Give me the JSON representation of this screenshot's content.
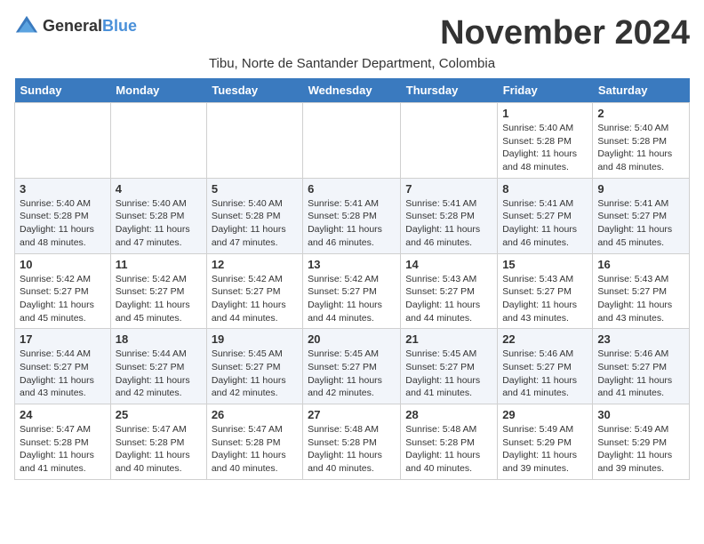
{
  "header": {
    "logo_general": "General",
    "logo_blue": "Blue",
    "month_title": "November 2024",
    "subtitle": "Tibu, Norte de Santander Department, Colombia"
  },
  "weekdays": [
    "Sunday",
    "Monday",
    "Tuesday",
    "Wednesday",
    "Thursday",
    "Friday",
    "Saturday"
  ],
  "weeks": [
    [
      {
        "day": "",
        "sunrise": "",
        "sunset": "",
        "daylight": ""
      },
      {
        "day": "",
        "sunrise": "",
        "sunset": "",
        "daylight": ""
      },
      {
        "day": "",
        "sunrise": "",
        "sunset": "",
        "daylight": ""
      },
      {
        "day": "",
        "sunrise": "",
        "sunset": "",
        "daylight": ""
      },
      {
        "day": "",
        "sunrise": "",
        "sunset": "",
        "daylight": ""
      },
      {
        "day": "1",
        "sunrise": "Sunrise: 5:40 AM",
        "sunset": "Sunset: 5:28 PM",
        "daylight": "Daylight: 11 hours and 48 minutes."
      },
      {
        "day": "2",
        "sunrise": "Sunrise: 5:40 AM",
        "sunset": "Sunset: 5:28 PM",
        "daylight": "Daylight: 11 hours and 48 minutes."
      }
    ],
    [
      {
        "day": "3",
        "sunrise": "Sunrise: 5:40 AM",
        "sunset": "Sunset: 5:28 PM",
        "daylight": "Daylight: 11 hours and 48 minutes."
      },
      {
        "day": "4",
        "sunrise": "Sunrise: 5:40 AM",
        "sunset": "Sunset: 5:28 PM",
        "daylight": "Daylight: 11 hours and 47 minutes."
      },
      {
        "day": "5",
        "sunrise": "Sunrise: 5:40 AM",
        "sunset": "Sunset: 5:28 PM",
        "daylight": "Daylight: 11 hours and 47 minutes."
      },
      {
        "day": "6",
        "sunrise": "Sunrise: 5:41 AM",
        "sunset": "Sunset: 5:28 PM",
        "daylight": "Daylight: 11 hours and 46 minutes."
      },
      {
        "day": "7",
        "sunrise": "Sunrise: 5:41 AM",
        "sunset": "Sunset: 5:28 PM",
        "daylight": "Daylight: 11 hours and 46 minutes."
      },
      {
        "day": "8",
        "sunrise": "Sunrise: 5:41 AM",
        "sunset": "Sunset: 5:27 PM",
        "daylight": "Daylight: 11 hours and 46 minutes."
      },
      {
        "day": "9",
        "sunrise": "Sunrise: 5:41 AM",
        "sunset": "Sunset: 5:27 PM",
        "daylight": "Daylight: 11 hours and 45 minutes."
      }
    ],
    [
      {
        "day": "10",
        "sunrise": "Sunrise: 5:42 AM",
        "sunset": "Sunset: 5:27 PM",
        "daylight": "Daylight: 11 hours and 45 minutes."
      },
      {
        "day": "11",
        "sunrise": "Sunrise: 5:42 AM",
        "sunset": "Sunset: 5:27 PM",
        "daylight": "Daylight: 11 hours and 45 minutes."
      },
      {
        "day": "12",
        "sunrise": "Sunrise: 5:42 AM",
        "sunset": "Sunset: 5:27 PM",
        "daylight": "Daylight: 11 hours and 44 minutes."
      },
      {
        "day": "13",
        "sunrise": "Sunrise: 5:42 AM",
        "sunset": "Sunset: 5:27 PM",
        "daylight": "Daylight: 11 hours and 44 minutes."
      },
      {
        "day": "14",
        "sunrise": "Sunrise: 5:43 AM",
        "sunset": "Sunset: 5:27 PM",
        "daylight": "Daylight: 11 hours and 44 minutes."
      },
      {
        "day": "15",
        "sunrise": "Sunrise: 5:43 AM",
        "sunset": "Sunset: 5:27 PM",
        "daylight": "Daylight: 11 hours and 43 minutes."
      },
      {
        "day": "16",
        "sunrise": "Sunrise: 5:43 AM",
        "sunset": "Sunset: 5:27 PM",
        "daylight": "Daylight: 11 hours and 43 minutes."
      }
    ],
    [
      {
        "day": "17",
        "sunrise": "Sunrise: 5:44 AM",
        "sunset": "Sunset: 5:27 PM",
        "daylight": "Daylight: 11 hours and 43 minutes."
      },
      {
        "day": "18",
        "sunrise": "Sunrise: 5:44 AM",
        "sunset": "Sunset: 5:27 PM",
        "daylight": "Daylight: 11 hours and 42 minutes."
      },
      {
        "day": "19",
        "sunrise": "Sunrise: 5:45 AM",
        "sunset": "Sunset: 5:27 PM",
        "daylight": "Daylight: 11 hours and 42 minutes."
      },
      {
        "day": "20",
        "sunrise": "Sunrise: 5:45 AM",
        "sunset": "Sunset: 5:27 PM",
        "daylight": "Daylight: 11 hours and 42 minutes."
      },
      {
        "day": "21",
        "sunrise": "Sunrise: 5:45 AM",
        "sunset": "Sunset: 5:27 PM",
        "daylight": "Daylight: 11 hours and 41 minutes."
      },
      {
        "day": "22",
        "sunrise": "Sunrise: 5:46 AM",
        "sunset": "Sunset: 5:27 PM",
        "daylight": "Daylight: 11 hours and 41 minutes."
      },
      {
        "day": "23",
        "sunrise": "Sunrise: 5:46 AM",
        "sunset": "Sunset: 5:27 PM",
        "daylight": "Daylight: 11 hours and 41 minutes."
      }
    ],
    [
      {
        "day": "24",
        "sunrise": "Sunrise: 5:47 AM",
        "sunset": "Sunset: 5:28 PM",
        "daylight": "Daylight: 11 hours and 41 minutes."
      },
      {
        "day": "25",
        "sunrise": "Sunrise: 5:47 AM",
        "sunset": "Sunset: 5:28 PM",
        "daylight": "Daylight: 11 hours and 40 minutes."
      },
      {
        "day": "26",
        "sunrise": "Sunrise: 5:47 AM",
        "sunset": "Sunset: 5:28 PM",
        "daylight": "Daylight: 11 hours and 40 minutes."
      },
      {
        "day": "27",
        "sunrise": "Sunrise: 5:48 AM",
        "sunset": "Sunset: 5:28 PM",
        "daylight": "Daylight: 11 hours and 40 minutes."
      },
      {
        "day": "28",
        "sunrise": "Sunrise: 5:48 AM",
        "sunset": "Sunset: 5:28 PM",
        "daylight": "Daylight: 11 hours and 40 minutes."
      },
      {
        "day": "29",
        "sunrise": "Sunrise: 5:49 AM",
        "sunset": "Sunset: 5:29 PM",
        "daylight": "Daylight: 11 hours and 39 minutes."
      },
      {
        "day": "30",
        "sunrise": "Sunrise: 5:49 AM",
        "sunset": "Sunset: 5:29 PM",
        "daylight": "Daylight: 11 hours and 39 minutes."
      }
    ]
  ]
}
